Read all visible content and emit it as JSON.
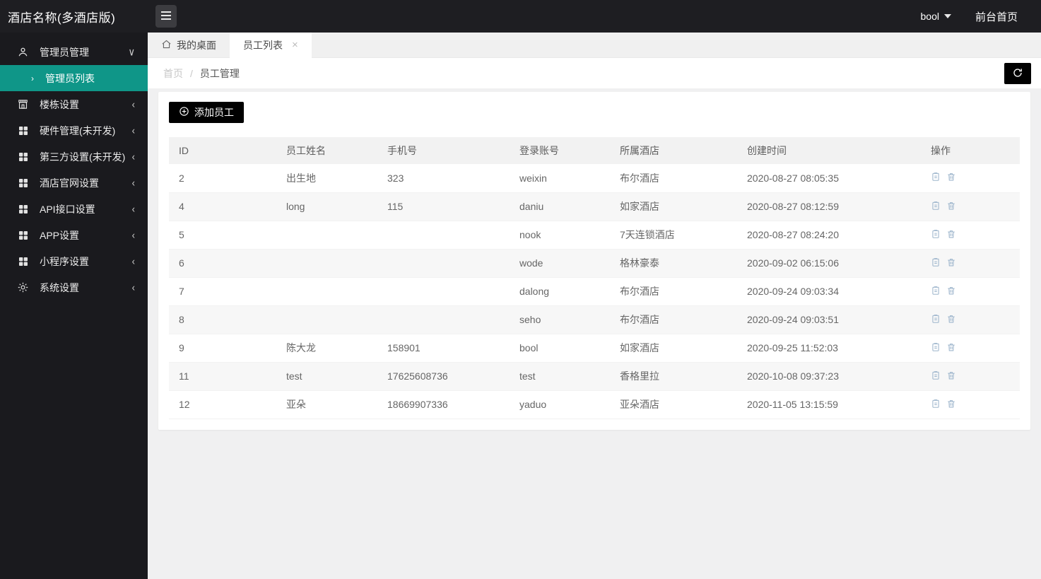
{
  "colors": {
    "accent_teal": "#0F9688",
    "topbar_bg": "#1E1E22",
    "sidebar_bg": "#1A1A1E",
    "black_button": "#000000",
    "action_icon": "#9DB5CC",
    "stripe_row": "#F7F7F7"
  },
  "topbar": {
    "title": "酒店名称(多酒店版)",
    "username": "bool",
    "front_home_label": "前台首页"
  },
  "sidebar": {
    "items": [
      {
        "label": "管理员管理",
        "icon": "admin-user-icon",
        "chevron": "down",
        "children": [
          {
            "label": "管理员列表",
            "active": true
          }
        ]
      },
      {
        "label": "楼栋设置",
        "icon": "building-icon",
        "chevron": "left"
      },
      {
        "label": "硬件管理(未开发)",
        "icon": "grid-icon",
        "chevron": "left"
      },
      {
        "label": "第三方设置(未开发)",
        "icon": "grid-icon",
        "chevron": "left"
      },
      {
        "label": "酒店官网设置",
        "icon": "grid-icon",
        "chevron": "left"
      },
      {
        "label": "API接口设置",
        "icon": "grid-icon",
        "chevron": "left"
      },
      {
        "label": "APP设置",
        "icon": "grid-icon",
        "chevron": "left"
      },
      {
        "label": "小程序设置",
        "icon": "grid-icon",
        "chevron": "left"
      },
      {
        "label": "系统设置",
        "icon": "gear-icon",
        "chevron": "left"
      }
    ],
    "chevron_down": "∨",
    "chevron_left": "‹",
    "sub_arrow": "›"
  },
  "tabs": [
    {
      "label": "我的桌面",
      "icon": "home-icon",
      "active": false
    },
    {
      "label": "员工列表",
      "active": true,
      "close": "×"
    }
  ],
  "breadcrumb": {
    "home": "首页",
    "separator": "/",
    "current": "员工管理"
  },
  "toolbar": {
    "add_employee_label": "添加员工"
  },
  "table": {
    "columns": [
      "ID",
      "员工姓名",
      "手机号",
      "登录账号",
      "所属酒店",
      "创建时间",
      "操作"
    ],
    "rows": [
      {
        "id": "2",
        "name": "出生地",
        "phone": "323",
        "account": "weixin",
        "hotel": "布尔酒店",
        "created": "2020-08-27 08:05:35"
      },
      {
        "id": "4",
        "name": "long",
        "phone": "115",
        "account": "daniu",
        "hotel": "如家酒店",
        "created": "2020-08-27 08:12:59"
      },
      {
        "id": "5",
        "name": "",
        "phone": "",
        "account": "nook",
        "hotel": "7天连锁酒店",
        "created": "2020-08-27 08:24:20"
      },
      {
        "id": "6",
        "name": "",
        "phone": "",
        "account": "wode",
        "hotel": "格林豪泰",
        "created": "2020-09-02 06:15:06"
      },
      {
        "id": "7",
        "name": "",
        "phone": "",
        "account": "dalong",
        "hotel": "布尔酒店",
        "created": "2020-09-24 09:03:34"
      },
      {
        "id": "8",
        "name": "",
        "phone": "",
        "account": "seho",
        "hotel": "布尔酒店",
        "created": "2020-09-24 09:03:51"
      },
      {
        "id": "9",
        "name": "陈大龙",
        "phone": "158901",
        "account": "bool",
        "hotel": "如家酒店",
        "created": "2020-09-25 11:52:03"
      },
      {
        "id": "11",
        "name": "test",
        "phone": "17625608736",
        "account": "test",
        "hotel": "香格里拉",
        "created": "2020-10-08 09:37:23"
      },
      {
        "id": "12",
        "name": "亚朵",
        "phone": "18669907336",
        "account": "yaduo",
        "hotel": "亚朵酒店",
        "created": "2020-11-05 13:15:59"
      }
    ]
  }
}
